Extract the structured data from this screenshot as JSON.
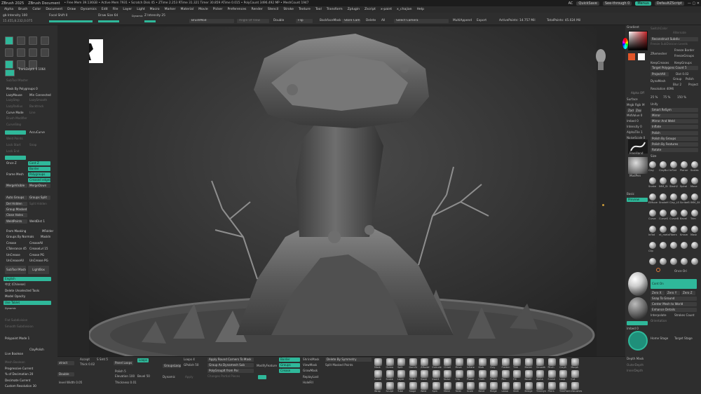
{
  "title_bar": {
    "app": "ZBrush 2025",
    "document": "ZBrush Document",
    "stats": "• Free Mem 39.136GB • Active Mem 7931 • Scratch Disk 45 • ZTime 2.253 RTime 31.321 Timer 30.859 ATime 0.015 • PolyCount 3496.492 MP • MeshCount 1947",
    "ac": "AC",
    "quicksave": "QuickSave",
    "seethrough": "See-through 0",
    "menus": "Menus",
    "default_script": "DefaultZScript"
  },
  "menubar": [
    "Alpha",
    "Brush",
    "Color",
    "Document",
    "Draw",
    "Dynamics",
    "Edit",
    "File",
    "Layer",
    "Light",
    "Macro",
    "Marker",
    "Material",
    "Movie",
    "Picker",
    "Preferences",
    "Render",
    "Stencil",
    "Stroke",
    "Texture",
    "Tool",
    "Transform",
    "Zplugin",
    "Zscript",
    "x-paint",
    "x_chajian",
    "Help"
  ],
  "top_shelf": {
    "rgb_intensity": "gb Intensity 100",
    "coords": "15.455,8.232,0.075",
    "focal_shift": "Focal Shift 0",
    "draw_size": "Draw Size 64",
    "dynamic": "Dynamic",
    "z_intensity": "Z Intensity 25",
    "brushmod": "BrushMod",
    "angle_of_view": "Angle Of View",
    "double": "Double",
    "flip": "Flip",
    "backfacemask": "BackfaceMask",
    "store_cam": "Store Cam",
    "delete": "Delete",
    "all": "All",
    "select_camera": "Select Camera",
    "multiappend": "MultiAppend",
    "export": "Export",
    "active_points": "ActivePoints: 14.757 Mil",
    "total_points": "TotalPoints: 45.024 Mil"
  },
  "left_tray": {
    "tool_icons": [
      "Edit",
      "Draw",
      "Move",
      "Scale",
      "Rotate",
      "Persp",
      "Floor",
      "Frame",
      "Setup",
      "Solo",
      "LSym",
      "Transp"
    ],
    "transdepth": "TransDepth 0 1064",
    "subtool_master": "SubTool Master",
    "mask_by_polygroups": "Mask By Polygroups 0",
    "lazymouse": "LazyMouse",
    "min_connected": "Min Connected",
    "lazystep": "LazyStep",
    "lazysmooth": "LazySmooth",
    "lazyradius": "LazyRadius",
    "backtrack": "Backtrack",
    "curve_mode": "Curve Mode",
    "line": "Line",
    "brush_modifier": "Brush Modifier",
    "curvestep": "CurveStep",
    "accucurve": "AccuCurve",
    "weld_points": "Weld Points",
    "lock_start": "Lock Start",
    "lock_end": "Lock End",
    "snap": "Snap",
    "once_z": "Once Z",
    "cont_z": "Cont Z",
    "border": "Border",
    "polygroups": "Polygroups",
    "creased_edges": "Creased edges",
    "frame_mesh": "Frame Mesh",
    "merge_visible": "MergeVisible",
    "merge_down": "MergeDown",
    "auto_groups": "Auto Groups",
    "groups_split": "Groups Split",
    "del_hidden": "Del Hidden",
    "split_hidden": "Split Hidden",
    "group_masked": "Group Masked",
    "close_holes": "Close Holes",
    "weldpoints": "WeldPoints",
    "weld_dist": "WeldDist 1",
    "from_masking": "From Masking",
    "mfolder": "MFolder",
    "groups_by_normals": "Groups By Normals",
    "maskin": "MaskIn",
    "crease": "Crease",
    "creaseall": "CreaseAll",
    "ctolerance": "CTolerance 45",
    "creaselvl": "CreaseLvl 15",
    "uncrease": "UnCrease",
    "uncreaseall": "UnCreaseAll",
    "crease_pg": "Crease PG",
    "uncrease_pg": "UnCrease PG",
    "subtool_master_btn": "SubTool Master",
    "lightbox": "LightBox",
    "english": "English",
    "chinese": "中文 (Chinese)",
    "delete_unselected": "Delete Unselected Tools",
    "model_opacity": "Model Opacity",
    "use_tablet": "Use Tablet",
    "dynamic_label": "Dynamic",
    "flat_subdivision": "Flat Subdivision",
    "smooth_subdivision": "Smooth Subdivision",
    "polypaint_mode": "Polypaint Mode 1",
    "live_boolean": "Live Boolean",
    "claypolish": "ClayPolish",
    "mesh_boolean": "Mesh Boolean",
    "progressive_current": "Progressive Current",
    "decimation": "% of Decimation 20",
    "decimate_current": "Decimate Current",
    "custom_resolution": "Custom Resolution 30"
  },
  "right_palette": {
    "gradient": "Gradient",
    "switchcolor": "SwitchColor",
    "alternate": "Alternate",
    "reconstruct_subdiv": "Reconstruct Subdiv",
    "freeze_subdivision": "Freeze SubDivision Levels",
    "freeze_border": "Freeze Border",
    "zremesher": "ZRemesher",
    "freezegroups": "FreezeGroups",
    "keepcreases": "KeepCreases",
    "keepgroups": "KeepGroups",
    "target_polygons": "Target Polygons Count 5",
    "project_all": "ProjectAll",
    "dist": "Dist 0.02",
    "dynamesh": "DynaMesh",
    "group": "Group",
    "polish": "Polish",
    "blur": "Blur 2",
    "project": "Project",
    "resolution": "Resolution 4096",
    "alpha_off": "Alpha Off",
    "surface": "Surface",
    "mrgb": "Mrgb",
    "rgb": "Rgb",
    "m": "M",
    "zadd": "Zadd",
    "zsub": "Zsub",
    "mid_value": "MidValue 0",
    "imbed": "Imbed 0",
    "intensity": "Intensity 0",
    "alpha_tile": "AlphaTile 1",
    "noise_scale": "NoiseScale 0",
    "freehand": "FreeHand",
    "modpen": "ModPen",
    "basic": "Basic",
    "preview": "Preview",
    "unify": "Unify",
    "smart_resym": "Smart ReSym",
    "mirror": "Mirror",
    "mirror_and_weld": "Mirror And Weld",
    "inflate": "Inflate",
    "polish_btn": "Polish",
    "polish_by_groups": "Polish By Groups",
    "polish_by_features": "Polish By Features",
    "rotate": "Rotate",
    "size": "Size",
    "sizes": [
      "25 %",
      "75 %",
      "150 %"
    ],
    "brush_names": [
      "Clay",
      "ClayBul",
      "InFlat",
      "Planar",
      "Scales",
      "Snake",
      "IMM_St",
      "Slash2",
      "Spiral",
      "Move",
      "ElMove",
      "SnakeH",
      "Clay_LS",
      "ScribeB",
      "IMM_SK",
      "Curve",
      "CurveS",
      "CurveB",
      "Bevel",
      "Trim",
      "Inflat",
      "nt_meta",
      "Fibers",
      "Kmsm",
      "Mask",
      "Clip"
    ],
    "cont_on": "Cont On",
    "once_ori": "Once Ori",
    "zero_x": "Zero X",
    "zero_y": "Zero Y",
    "zero_z": "Zero Z",
    "snap_to_ground": "Snap To Ground",
    "center_mesh": "Center Mesh to World",
    "enhance_details": "Enhance Details",
    "interpolate": "Interpolate",
    "strokes_count": "Strokes Count",
    "orientation": "Orientation",
    "imbed_val": "Imbed 0",
    "home_stage": "Home Stage",
    "target_stage": "Target Stage",
    "depth_mask": "Depth Mask",
    "outer_depth": "OuterDepth",
    "inner_depth": "InnerDepth"
  },
  "bottom_shelf": {
    "extract": "xtract",
    "accept": "Accept",
    "s_smt": "S Smt 5",
    "double": "Double",
    "thick": "Thick 0.02",
    "panel_loops": "Panel Loops",
    "loops": "Loops",
    "loops_val": "Loops 4",
    "polish": "Polish 5",
    "bevel": "Bevel 50",
    "elevation": "Elevation 100",
    "thickness": "Thickness 0.01",
    "group_loops": "GroupsLoops",
    "gpolish": "GPolish 50",
    "dynamic": "Dynamic",
    "apply_round": "Apply Round Corners To Mask",
    "group_as_dynamesh": "Group As Dynamesh Sub",
    "polygroupit": "PolyGroupIt from Pai",
    "changes_partial": "Changes Partial Pieces",
    "modify_feature": "ModifyFeature",
    "border": "Border",
    "groups": "Groups",
    "crease": "Crease",
    "shrinkmask": "ShrinkMask",
    "viewmask": "ViewMask",
    "growmask": "GrowMask",
    "replaylast": "ReplayLast",
    "holefill": "HoleFill",
    "delete_by_symmetry": "Delete By Symmetry",
    "split_masked": "Split Masked Points",
    "apply": "Apply",
    "level_width": "level Width 0.05",
    "icon_labels": [
      "Mask",
      "Gizmo",
      "Split",
      "DamSt",
      "ZModel",
      "Extrude",
      "Chisel",
      "Move",
      "Inflate",
      "Blob",
      "Clay",
      "Flatten",
      "Trim",
      "Mallet",
      "Smooth",
      "Pinch",
      "ClayB",
      "Morph",
      "Curve",
      "Snake",
      "Layer",
      "Stitch",
      "Slash",
      "Insert",
      "Noise",
      "Clip",
      "Planar",
      "Cloth",
      "Polish",
      "Pen",
      "Fill",
      "Bevel",
      "Alpha",
      "Frame",
      "Loop",
      "Cut",
      "Wrap",
      "Sculpt",
      "Tube",
      "Stage",
      "Weld",
      "Spin",
      "Mesh",
      "Twist",
      "Scale",
      "Bend",
      "Ridge",
      "Lasso",
      "Shell",
      "Bridge",
      "TrimDyn",
      "Pliers",
      "TrimFront",
      "Zbrushes"
    ]
  },
  "colors": {
    "accent": "#2fb89a",
    "panel": "#2e2e2e",
    "viewport_bg": "#2a2a2a",
    "title": "#1c1c1c"
  }
}
